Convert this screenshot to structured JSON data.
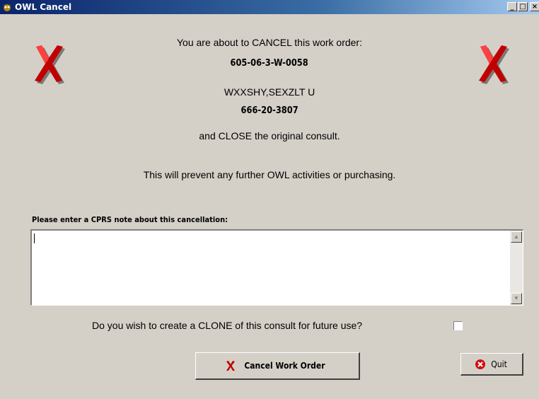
{
  "window": {
    "title": "OWL Cancel",
    "app_icon": "owl-app-icon",
    "controls": {
      "minimize": "_",
      "maximize": "□",
      "close": "×"
    }
  },
  "message": {
    "line1": "You are about to CANCEL this work order:",
    "work_order_number": "605-06-3-W-0058",
    "patient_name": "WXXSHY,SEXZLT U",
    "patient_id": "666-20-3807",
    "line3": "and CLOSE the original consult.",
    "line4": "This will prevent any further OWL activities or purchasing."
  },
  "icons": {
    "left": "red-x-icon",
    "right": "red-x-icon"
  },
  "note": {
    "label": "Please enter a CPRS note about this cancellation:",
    "value": ""
  },
  "clone": {
    "question": "Do you wish to create a CLONE of this consult for future use?",
    "checked": false
  },
  "buttons": {
    "cancel_work_order": "Cancel Work Order",
    "quit": "Quit"
  },
  "colors": {
    "accent_red": "#cc0000",
    "window_bg": "#d4d0c8",
    "title_bar": "#0a246a"
  }
}
